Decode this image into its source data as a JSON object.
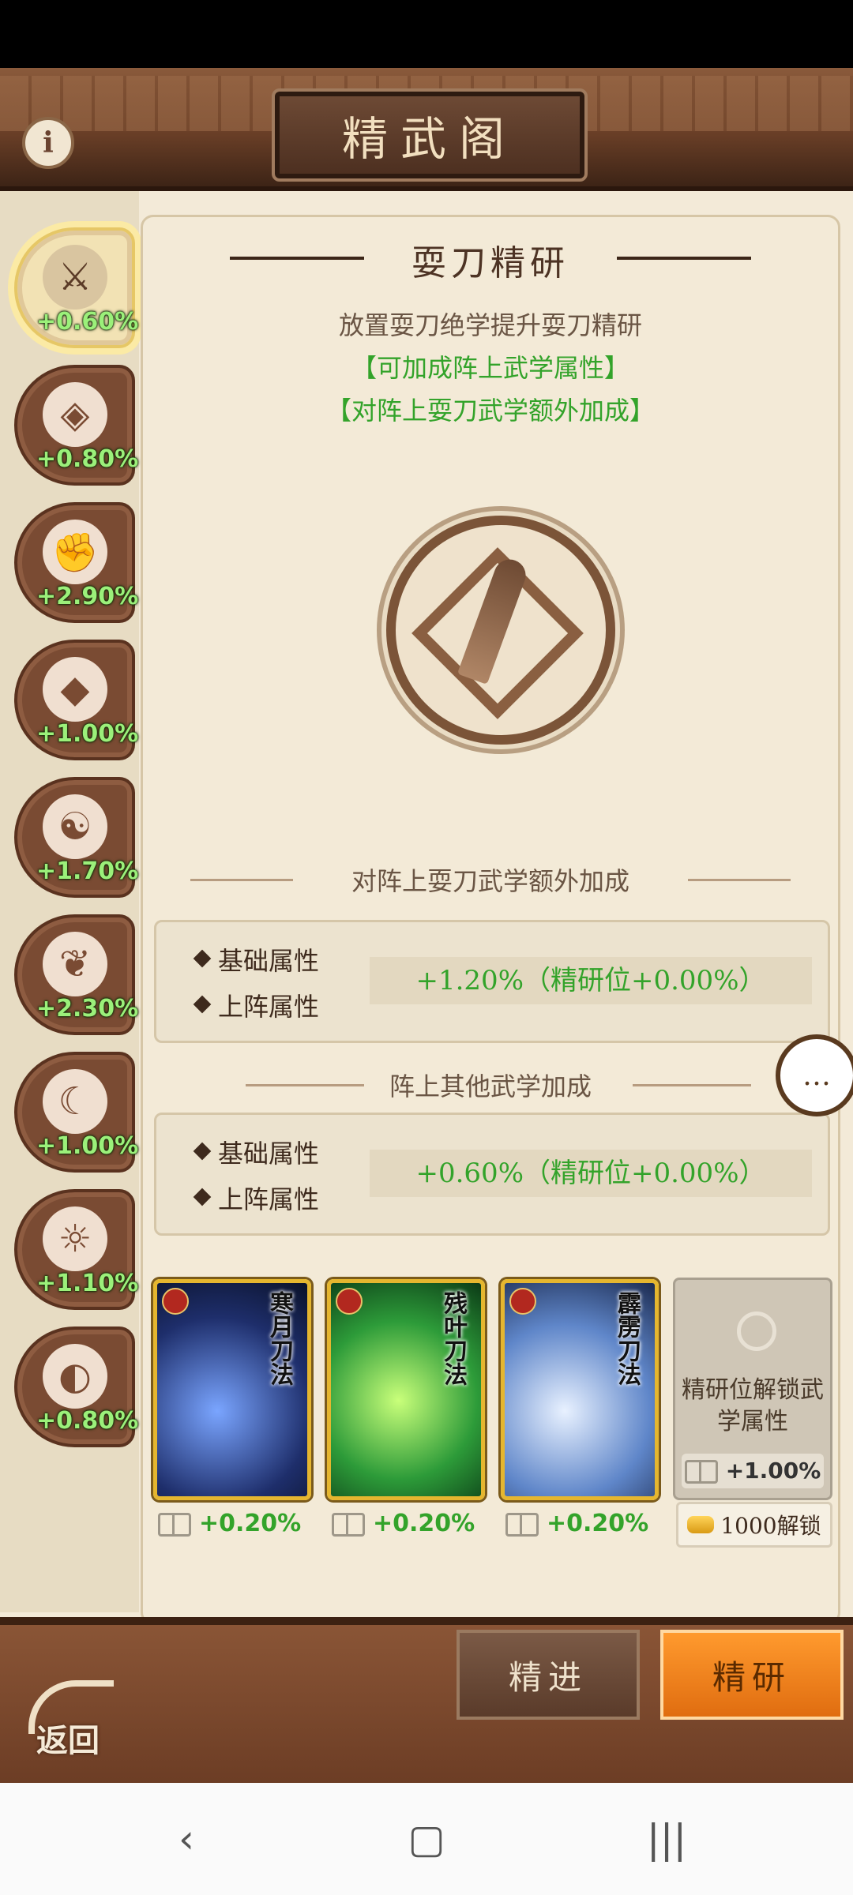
{
  "header": {
    "title": "精武阁"
  },
  "sidebar": {
    "items": [
      {
        "percent": "+0.60%",
        "icon": "broadsword-icon",
        "active": true
      },
      {
        "percent": "+0.80%",
        "icon": "shield-crest-icon",
        "active": false
      },
      {
        "percent": "+2.90%",
        "icon": "fist-icon",
        "active": false
      },
      {
        "percent": "+1.00%",
        "icon": "fan-icon",
        "active": false
      },
      {
        "percent": "+1.70%",
        "icon": "taiji-icon",
        "active": false
      },
      {
        "percent": "+2.30%",
        "icon": "crane-icon",
        "active": false
      },
      {
        "percent": "+1.00%",
        "icon": "crescent-moon-icon",
        "active": false
      },
      {
        "percent": "+1.10%",
        "icon": "sun-icon",
        "active": false
      },
      {
        "percent": "+0.80%",
        "icon": "sun-moon-icon",
        "active": false
      }
    ]
  },
  "panel": {
    "title": "耍刀精研",
    "description": "放置耍刀绝学提升耍刀精研",
    "bonus_line1": "【可加成阵上武学属性】",
    "bonus_line2": "【对阵上耍刀武学额外加成】",
    "section1_title": "对阵上耍刀武学额外加成",
    "section1": {
      "base_label": "基础属性",
      "battle_label": "上阵属性",
      "value": "+1.20%（精研位+0.00%）"
    },
    "section2_title": "阵上其他武学加成",
    "section2": {
      "base_label": "基础属性",
      "battle_label": "上阵属性",
      "value": "+0.60%（精研位+0.00%）"
    }
  },
  "cards": [
    {
      "name": "寒月刀法",
      "bonus": "+0.20%"
    },
    {
      "name": "残叶刀法",
      "bonus": "+0.20%"
    },
    {
      "name": "霹雳刀法",
      "bonus": "+0.20%"
    }
  ],
  "locked_slot": {
    "text": "精研位解锁武学属性",
    "bonus": "+1.00%",
    "unlock_label": "1000解锁"
  },
  "bottom": {
    "tab_jinjin": "精进",
    "tab_jingyan": "精研",
    "back_label": "返回"
  }
}
